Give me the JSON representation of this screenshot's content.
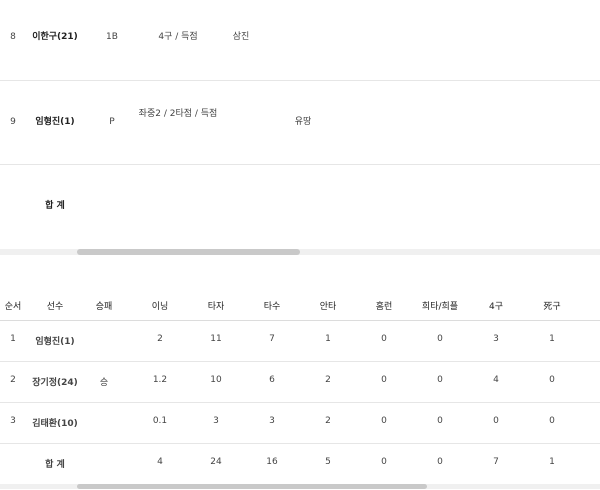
{
  "top_table": {
    "rows": [
      {
        "order": "8",
        "player": "이한구(21)",
        "pos": "1B",
        "result1": "4구 / 득점",
        "result2": "삼진",
        "result3": ""
      },
      {
        "order": "9",
        "player": "임형진(1)",
        "pos": "P",
        "result1": "좌중2 / 2타점 / 득점",
        "result2": "",
        "result3": "유땅"
      }
    ],
    "total_label": "합 계"
  },
  "pitch_table": {
    "headers": [
      "순서",
      "선수",
      "승패",
      "이닝",
      "타자",
      "타수",
      "안타",
      "홈런",
      "희타/희플",
      "4구",
      "死구"
    ],
    "rows": [
      {
        "order": "1",
        "player": "임형진(1)",
        "decision": "",
        "innings": "2",
        "batters": "11",
        "at_bats": "7",
        "hits": "1",
        "hr": "0",
        "sac": "0",
        "bb": "3",
        "hbp": "1"
      },
      {
        "order": "2",
        "player": "장기정(24)",
        "decision": "승",
        "innings": "1.2",
        "batters": "10",
        "at_bats": "6",
        "hits": "2",
        "hr": "0",
        "sac": "0",
        "bb": "4",
        "hbp": "0"
      },
      {
        "order": "3",
        "player": "김태환(10)",
        "decision": "",
        "innings": "0.1",
        "batters": "3",
        "at_bats": "3",
        "hits": "2",
        "hr": "0",
        "sac": "0",
        "bb": "0",
        "hbp": "0"
      }
    ],
    "total": {
      "label": "합 계",
      "innings": "4",
      "batters": "24",
      "at_bats": "16",
      "hits": "5",
      "hr": "0",
      "sac": "0",
      "bb": "7",
      "hbp": "1"
    }
  }
}
